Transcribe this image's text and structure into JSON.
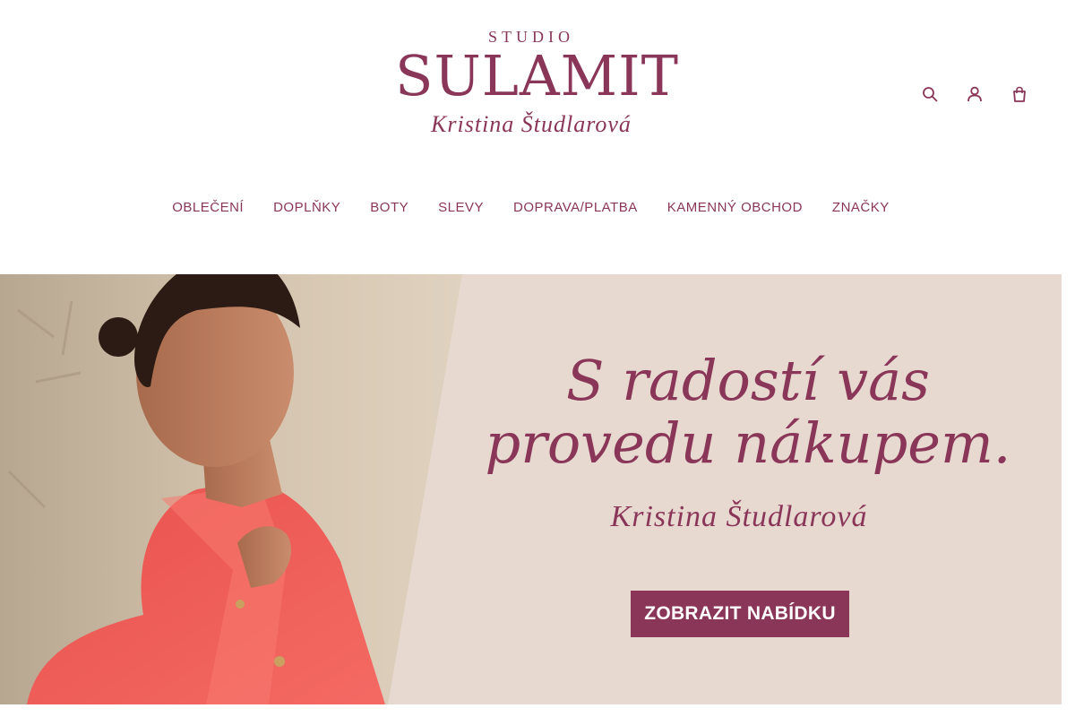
{
  "logo": {
    "studio": "STUDIO",
    "name": "SULAMIT",
    "signature": "Kristina Študlarová"
  },
  "header_icons": [
    "search-icon",
    "user-icon",
    "cart-icon"
  ],
  "nav": {
    "items": [
      "OBLEČENÍ",
      "DOPLŇKY",
      "BOTY",
      "SLEVY",
      "DOPRAVA/PLATBA",
      "KAMENNÝ OBCHOD",
      "ZNAČKY"
    ]
  },
  "hero": {
    "headline_line1": "S radostí vás",
    "headline_line2": "provedu nákupem.",
    "signature": "Kristina Študlarová",
    "cta_label": "ZOBRAZIT NABÍDKU"
  },
  "colors": {
    "brand": "#8a3658",
    "hero_background": "#e7d9d0",
    "jacket": "#f0605c"
  }
}
